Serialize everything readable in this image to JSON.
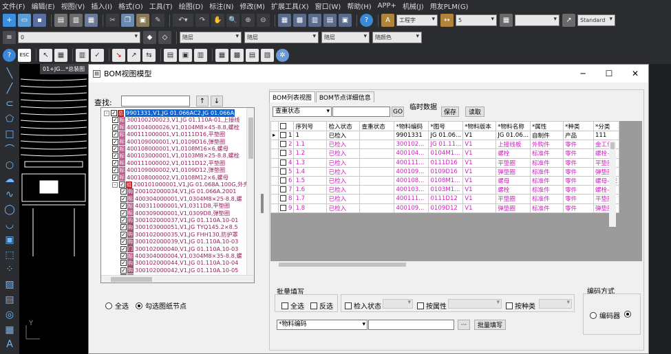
{
  "menu": [
    "文件(F)",
    "编辑(E)",
    "视图(V)",
    "插入(I)",
    "格式(O)",
    "工具(T)",
    "绘图(D)",
    "标注(N)",
    "修改(M)",
    "扩展工具(X)",
    "窗口(W)",
    "帮助(H)",
    "APP+",
    "机械(J)",
    "用友PLM(G)"
  ],
  "toolbar": {
    "text_style": "工程字",
    "dim_value": "5",
    "standard": "Standard",
    "layer_value": "0",
    "layer_by": "随层",
    "linetype": "随层",
    "lineweight": "随层",
    "plotcolor": "随颜色"
  },
  "cad_tab": "01+JG...*总装图",
  "window": {
    "title": "BOM视图模型",
    "minimize": "─",
    "maximize": "☐",
    "close": "✕"
  },
  "left": {
    "search_label": "查找:",
    "up": "↑",
    "down": "↓",
    "tree": [
      {
        "tag": "总",
        "text": "9901331,V1,JG 01.066AC2,JG 01.066A",
        "sel": true,
        "lvl": 0,
        "exp": "-"
      },
      {
        "tag": "标",
        "text": "300100200023,V1,JG 01.110A-01,上接线",
        "lvl": 1
      },
      {
        "tag": "标",
        "text": "400104000026,V1,0104M8×45-8.8,螺栓",
        "lvl": 1
      },
      {
        "tag": "标",
        "text": "400111000001,V1,0111D16,平垫圈",
        "lvl": 1
      },
      {
        "tag": "标",
        "text": "400109000001,V1,0109D16,弹垫圈",
        "lvl": 1
      },
      {
        "tag": "标",
        "text": "400108000001,V1,0108M16×6,螺母",
        "lvl": 1
      },
      {
        "tag": "标",
        "text": "400103000001,V1,0103M8×25-8.8,螺栓",
        "lvl": 1
      },
      {
        "tag": "标",
        "text": "400111000002,V1,0111D12,平垫圈",
        "lvl": 1
      },
      {
        "tag": "标",
        "text": "400109000002,V1,0109D12,弹垫圈",
        "lvl": 1
      },
      {
        "tag": "标",
        "text": "400108000002,V1,0108M12×6,螺母",
        "lvl": 1
      },
      {
        "tag": "组",
        "text": "200101000001,V1,JG 01.068A.100G,外壳",
        "lvl": 1,
        "exp": "-"
      },
      {
        "tag": "购",
        "text": "200102000034,V1,JG 01.066A.2001",
        "lvl": 2
      },
      {
        "tag": "标",
        "text": "400304000001,V1,0304M8×25-8.8,螺",
        "lvl": 2
      },
      {
        "tag": "标",
        "text": "400311000001,V1,0311D8,平垫圈",
        "lvl": 2
      },
      {
        "tag": "标",
        "text": "400309000001,V1,0309D8,弹垫圈",
        "lvl": 2
      },
      {
        "tag": "购",
        "text": "300102000037,V1,JG 01.110A.10-01",
        "lvl": 2
      },
      {
        "tag": "购",
        "text": "300103000051,V1,JG TYQ145.2×8.5",
        "lvl": 2
      },
      {
        "tag": "购",
        "text": "300102000035,V1,JG FHH130,防护罩",
        "lvl": 2
      },
      {
        "tag": "购",
        "text": "300102000039,V1,JG 01.110A.10-03",
        "lvl": 2
      },
      {
        "tag": "门",
        "text": "300102000040,V1,JG 01.110A.10-03",
        "lvl": 2
      },
      {
        "tag": "标",
        "text": "400304000004,V1,0304M8×35-8.8,螺",
        "lvl": 2
      },
      {
        "tag": "购",
        "text": "300102000044,V1,JG 01.110A.10-04",
        "lvl": 2
      },
      {
        "tag": "购",
        "text": "300102000042,V1,JG 01.110A.10-05",
        "lvl": 2
      },
      {
        "tag": "购",
        "text": "300102000043,V1,JG 01.110A.10-07",
        "lvl": 2
      }
    ],
    "radio_all": "全选",
    "radio_checked": "勾选图纸节点"
  },
  "right": {
    "tabs": [
      "BOM列表视图",
      "BOM节点详细信息"
    ],
    "temp_label": "临时数据",
    "filter_select": "查重状态",
    "go": "GO",
    "save": "保存",
    "read": "读取",
    "columns": [
      "",
      "序列号",
      "检入状态",
      "查重状态",
      "*物料编码",
      "*图号",
      "*物料版本",
      "*物料名称",
      "*属性",
      "*种类",
      "*分类"
    ],
    "rows": [
      [
        "1",
        "1",
        "已检入",
        "",
        "9901331",
        "JG 01.06...",
        "V1",
        "JG 01.06...",
        "自制件",
        "产品",
        "111"
      ],
      [
        "2",
        "1.1",
        "已检入",
        "",
        "300102...",
        "JG 01.11...",
        "V1",
        "上接线板",
        "外购件",
        "零件",
        "金工件"
      ],
      [
        "3",
        "1.2",
        "已检入",
        "",
        "400104...",
        "0104M1...",
        "V1",
        "螺栓",
        "标准件",
        "零件",
        "螺栓-全"
      ],
      [
        "4",
        "1.3",
        "已检入",
        "",
        "400111...",
        "0111D16",
        "V1",
        "平垫圈",
        "标准件",
        "零件",
        "平垫圈-"
      ],
      [
        "5",
        "1.4",
        "已检入",
        "",
        "400109...",
        "0109D16",
        "V1",
        "弹垫圈",
        "标准件",
        "零件",
        "弹垫圈-"
      ],
      [
        "6",
        "1.5",
        "已检入",
        "",
        "400108...",
        "0108M1...",
        "V1",
        "螺母",
        "标准件",
        "零件",
        "螺母-GE"
      ],
      [
        "7",
        "1.6",
        "已检入",
        "",
        "400103...",
        "0103M1...",
        "V1",
        "螺栓",
        "标准件",
        "零件",
        "螺栓-半"
      ],
      [
        "8",
        "1.7",
        "已检入",
        "",
        "400111...",
        "0111D12",
        "V1",
        "平垫圈",
        "标准件",
        "零件",
        "平垫圈-"
      ],
      [
        "9",
        "1.8",
        "已检入",
        "",
        "400109...",
        "0109D12",
        "V1",
        "弹垫圈",
        "标准件",
        "零件",
        "弹垫圈-"
      ]
    ],
    "batch_label": "批量填写",
    "cb_all": "全选",
    "cb_invert": "反选",
    "cb_checkin": "检入状态",
    "cb_attr": "按属性",
    "cb_kind": "按种类",
    "encode_select": "*物料编码",
    "ellipsis": "···",
    "batch_btn": "批量填写",
    "encode_label": "编码方式",
    "encoder": "编码器"
  }
}
